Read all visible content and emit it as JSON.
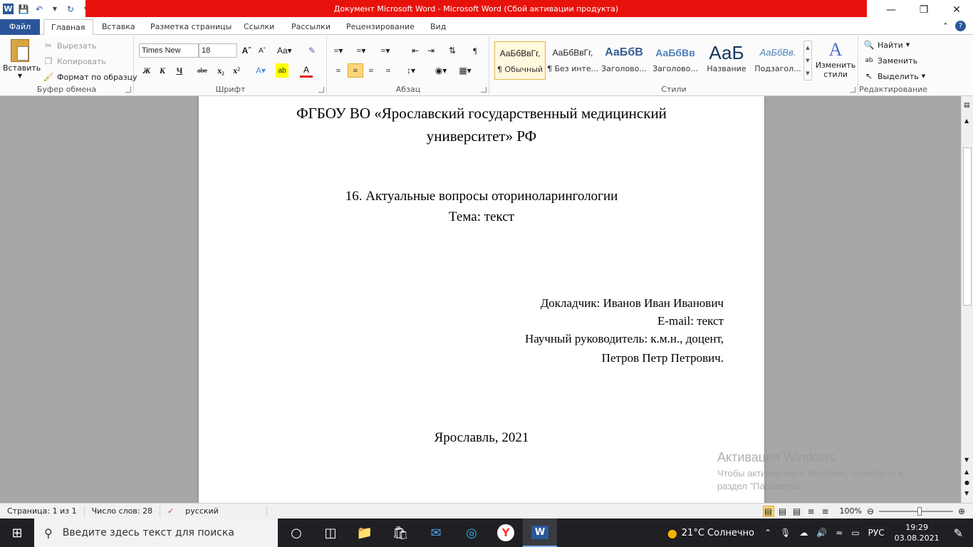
{
  "titlebar": {
    "title": "Документ Microsoft Word  -  Microsoft Word (Сбой активации продукта)"
  },
  "tabs": [
    "Файл",
    "Главная",
    "Вставка",
    "Разметка страницы",
    "Ссылки",
    "Рассылки",
    "Рецензирование",
    "Вид"
  ],
  "clipboard": {
    "paste": "Вставить",
    "cut": "Вырезать",
    "copy": "Копировать",
    "format_painter": "Формат по образцу",
    "label": "Буфер обмена"
  },
  "font": {
    "name": "Times New Roman",
    "size": "18",
    "label": "Шрифт",
    "bold": "Ж",
    "italic": "К",
    "underline": "Ч",
    "strike": "abe"
  },
  "paragraph": {
    "label": "Абзац"
  },
  "styles": {
    "label": "Стили",
    "items": [
      {
        "preview": "АаБбВвГг,",
        "name": "¶ Обычный"
      },
      {
        "preview": "АаБбВвГг,",
        "name": "¶ Без инте..."
      },
      {
        "preview": "АаБбВ",
        "name": "Заголово..."
      },
      {
        "preview": "АаБбВв",
        "name": "Заголово..."
      },
      {
        "preview": "АаБ",
        "name": "Название"
      },
      {
        "preview": "АаБбВв.",
        "name": "Подзагол..."
      }
    ],
    "change": "Изменить стили"
  },
  "editing": {
    "find": "Найти",
    "replace": "Заменить",
    "select": "Выделить",
    "label": "Редактирование"
  },
  "document": {
    "org_line1": "ФГБОУ ВО «Ярославский государственный медицинский",
    "org_line2": "университет» РФ",
    "section": "16. Актуальные вопросы оториноларингологии",
    "topic": "Тема: текст",
    "speaker": "Докладчик: Иванов Иван Иванович",
    "email": "E-mail: текст",
    "supervisor": "Научный руководитель: к.м.н., доцент,",
    "supervisor_name": "Петров Петр Петрович.",
    "city_year": "Ярославль, 2021"
  },
  "watermark": {
    "line1": "Активация Windows",
    "line2": "Чтобы активировать Windows, перейдите в",
    "line3": "раздел \"Параметры\"."
  },
  "status": {
    "page": "Страница: 1 из 1",
    "words": "Число слов: 28",
    "lang": "русский",
    "zoom": "100%"
  },
  "taskbar": {
    "search_placeholder": "Введите здесь текст для поиска",
    "weather": "21°C  Солнечно",
    "lang": "РУС",
    "time": "19:29",
    "date": "03.08.2021"
  }
}
